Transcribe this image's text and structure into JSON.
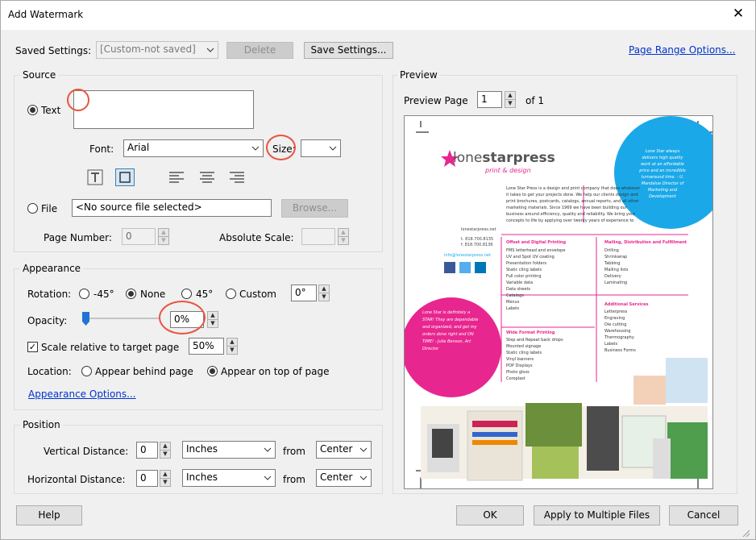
{
  "window": {
    "title": "Add Watermark",
    "close_glyph": "✕"
  },
  "saved": {
    "label": "Saved Settings:",
    "value": "[Custom-not saved]",
    "delete": "Delete",
    "save": "Save Settings...",
    "page_range": "Page Range Options..."
  },
  "source": {
    "title": "Source",
    "text_label": "Text",
    "font_label": "Font:",
    "font_value": "Arial",
    "size_label": "Size:",
    "file_label": "File",
    "file_value": "<No source file selected>",
    "browse": "Browse...",
    "page_number_label": "Page Number:",
    "page_number_value": "0",
    "absolute_scale_label": "Absolute Scale:"
  },
  "appearance": {
    "title": "Appearance",
    "rotation_label": "Rotation:",
    "rot_m45": "-45°",
    "rot_none": "None",
    "rot_45": "45°",
    "rot_custom": "Custom",
    "rot_value": "0°",
    "opacity_label": "Opacity:",
    "opacity_value": "0%",
    "scale_label": "Scale relative to target page",
    "scale_value": "50%",
    "location_label": "Location:",
    "loc_behind": "Appear behind page",
    "loc_top": "Appear on top of page",
    "options_link": "Appearance Options..."
  },
  "position": {
    "title": "Position",
    "vertical_label": "Vertical Distance:",
    "vertical_value": "0",
    "vertical_unit": "Inches",
    "vertical_from_label": "from",
    "vertical_from": "Center",
    "horizontal_label": "Horizontal Distance:",
    "horizontal_value": "0",
    "horizontal_unit": "Inches",
    "horizontal_from_label": "from",
    "horizontal_from": "Center"
  },
  "preview": {
    "title": "Preview",
    "page_label": "Preview Page",
    "page_value": "1",
    "of_label": "of 1",
    "doc": {
      "brand_a": "lone",
      "brand_b": "starpress",
      "tagline": "print & design",
      "intro": "Lone Star Press is a design and print company that does whatever it takes to get your projects done. We help our clients design and print brochures, postcards, catalogs, annual reports, and all other marketing materials. Since 1969 we have been building our business around efficiency, quality and reliability. We bring your concepts to life by applying over twenty years of experience to each project. Let us show you what we can do for you.",
      "quote_top": "Lone Star always delivers high quality work at an affordable price and an incredible turnaround time. - U. Mandalue Director of Marketing and Development",
      "quote_bottom": "Lone Star is definitely a STAR! They are dependable and organized, and get my orders done right and ON TIME! - Julie Benson, Art Director",
      "website": "lonestarpress.net",
      "phone1": "t. 818.700.8135",
      "phone2": "f. 818.700.8136",
      "email": "info@lonestarpress.net",
      "col1_head": "Offset and Digital Printing",
      "col1_items": [
        "FMS letterhead and envelope",
        "UV and Spot UV coating",
        "Presentation folders",
        "Static cling labels",
        "Full color printing",
        "Variable data",
        "Data sheets",
        "Catalogs",
        "Menus",
        "Labels"
      ],
      "col2_head": "Mailing, Distribution and Fulfillment",
      "col2_items": [
        "Drilling",
        "Shrinkwrap",
        "Tabbing",
        "Mailing lists",
        "Delivery",
        "Laminating"
      ],
      "col3_head": "Wide Format Printing",
      "col3_items": [
        "Step and Repeat back drops",
        "Mounted signage",
        "Static cling labels",
        "Vinyl banners",
        "POP Displays",
        "Photo gloss",
        "Coroplast"
      ],
      "col4_head": "Additional Services",
      "col4_items": [
        "Letterpress",
        "Engraving",
        "Die cutting",
        "Warehousing",
        "Thermography",
        "Labels",
        "Business Forms"
      ]
    }
  },
  "footer": {
    "help": "Help",
    "ok": "OK",
    "apply_multiple": "Apply to Multiple Files",
    "cancel": "Cancel"
  },
  "colors": {
    "accent_pink": "#e8268f",
    "accent_cyan": "#1ba8e8",
    "annotation": "#e8553f",
    "link": "#0033cc"
  }
}
